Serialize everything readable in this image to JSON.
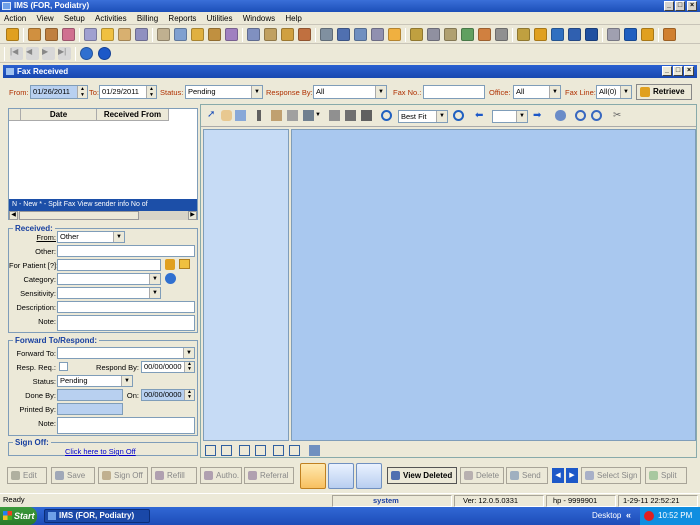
{
  "app": {
    "title": "IMS (FOR, Podiatry)"
  },
  "menu": [
    "Action",
    "View",
    "Setup",
    "Activities",
    "Billing",
    "Reports",
    "Utilities",
    "Windows",
    "Help"
  ],
  "window": {
    "title": "Fax Received",
    "min": "_",
    "max": "□",
    "close": "X"
  },
  "filters": {
    "from_label": "From:",
    "from_value": "01/26/2011",
    "to_label": "To:",
    "to_value": "01/29/2011",
    "status_label": "Status:",
    "status_value": "Pending",
    "response_label": "Response By:",
    "response_value": "All",
    "faxno_label": "Fax No.:",
    "faxno_value": "",
    "office_label": "Office:",
    "office_value": "All",
    "faxline_label": "Fax Line:",
    "faxline_value": "All(0)",
    "retrieve_label": "Retrieve"
  },
  "grid": {
    "columns": [
      "Date",
      "Received From"
    ],
    "footer": "N - New  * - Split Fax   View sender info        No of"
  },
  "received": {
    "title": "Received:",
    "from_label": "From:",
    "from_value": "Other",
    "other_label": "Other:",
    "patient_label": "For Patient [?]:",
    "category_label": "Category:",
    "sensitivity_label": "Sensitivity:",
    "description_label": "Description:",
    "note_label": "Note:"
  },
  "forward": {
    "title": "Forward To/Respond:",
    "forward_label": "Forward To:",
    "resp_req_label": "Resp. Req.:",
    "respond_by_label": "Respond By:",
    "respond_by_value": "00/00/0000",
    "status_label": "Status:",
    "status_value": "Pending",
    "done_by_label": "Done By:",
    "on_label": "On:",
    "on_value": "00/00/0000",
    "printed_by_label": "Printed By:",
    "note_label": "Note:"
  },
  "signoff": {
    "label": "Sign Off:",
    "link": "Click here to Sign Off"
  },
  "viewer": {
    "zoom": "Best Fit",
    "page": ""
  },
  "actions": {
    "edit": "Edit",
    "save": "Save",
    "sign_off": "Sign Off",
    "refill": "Refill",
    "autho": "Autho.",
    "referral": "Referral",
    "view_deleted": "View Deleted",
    "delete": "Delete",
    "send": "Send",
    "select_sign": "Select Sign",
    "split": "Split"
  },
  "status": {
    "ready": "Ready",
    "user": "system",
    "version": "Ver: 12.0.5.0331",
    "machine": "hp - 9999901",
    "datetime": "1-29-11 22:52:21"
  },
  "taskbar": {
    "start": "Start",
    "task": "IMS (FOR, Podiatry)",
    "desktop": "Desktop",
    "clock": "10:52 PM"
  },
  "colors": {
    "title": "#1c4fb8",
    "canvas": "#a9c8ef",
    "thumbs": "#c6dbf5",
    "label_accent": "#b03000"
  }
}
